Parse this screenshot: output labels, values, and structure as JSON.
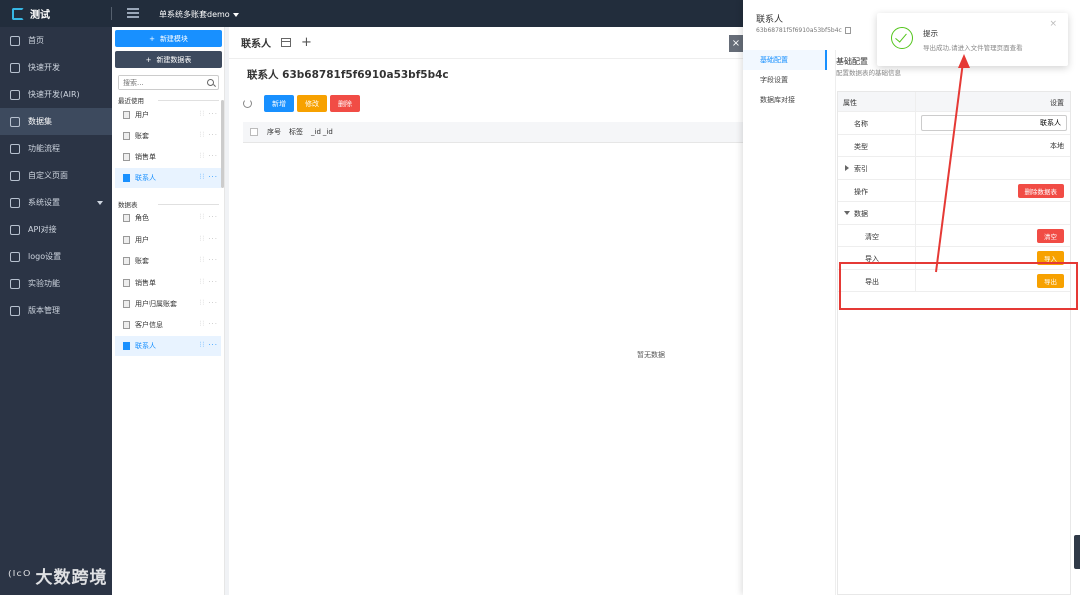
{
  "app": {
    "title": "测试",
    "project": "单系统多账套demo"
  },
  "sidenav": [
    {
      "label": "首页",
      "icon": "home-icon"
    },
    {
      "label": "快速开发",
      "icon": "cube-icon"
    },
    {
      "label": "快速开发(AIR)",
      "icon": "cube-icon"
    },
    {
      "label": "数据集",
      "icon": "database-icon",
      "active": true
    },
    {
      "label": "功能流程",
      "icon": "flow-icon"
    },
    {
      "label": "自定义页面",
      "icon": "page-icon"
    },
    {
      "label": "系统设置",
      "icon": "settings-icon"
    },
    {
      "label": "API对接",
      "icon": "api-icon"
    },
    {
      "label": "logo设置",
      "icon": "image-icon"
    },
    {
      "label": "实验功能",
      "icon": "monitor-icon"
    },
    {
      "label": "版本管理",
      "icon": "monitor-icon"
    }
  ],
  "panel": {
    "new_module": "新建模块",
    "new_dataset": "新建数据表",
    "search_placeholder": "搜索...",
    "recent_title": "最近使用",
    "recent": [
      "用户",
      "账套",
      "销售单",
      "联系人"
    ],
    "tables_title": "数据表",
    "tables": [
      "角色",
      "用户",
      "账套",
      "销售单",
      "用户归属账套",
      "客户信息",
      "联系人"
    ]
  },
  "main": {
    "tab": "联系人",
    "title": "联系人 63b68781f5f6910a53bf5b4c",
    "btn_add": "新增",
    "btn_edit": "修改",
    "btn_delete": "删除",
    "columns": [
      "序号",
      "标签",
      "_id",
      "_id"
    ],
    "empty": "暂无数据",
    "close": "×"
  },
  "drawer": {
    "title": "联系人",
    "id": "63b68781f5f6910a53bf5b4c",
    "menu": [
      "基础配置",
      "字段设置",
      "数据库对接"
    ],
    "section_title": "基础配置",
    "section_sub": "配置数据表的基础信息",
    "header_attr": "属性",
    "header_setting": "设置",
    "rows": {
      "name_label": "名称",
      "name_value": "联系人",
      "type_label": "类型",
      "type_value": "本地",
      "index_label": "索引",
      "op_label": "操作",
      "op_button": "删除数据表",
      "data_label": "数据",
      "clear_label": "清空",
      "clear_button": "清空",
      "import_label": "导入",
      "import_button": "导入",
      "export_label": "导出",
      "export_button": "导出"
    }
  },
  "notify": {
    "title": "提示",
    "message": "导出成功,请进入文件管理页面查看"
  },
  "watermark": "大数跨境",
  "watermark_logo": "⁽ᴵᶜᴼ",
  "colors": {
    "primary": "#1890ff",
    "annotation": "#e53935",
    "success": "#52c41a"
  }
}
